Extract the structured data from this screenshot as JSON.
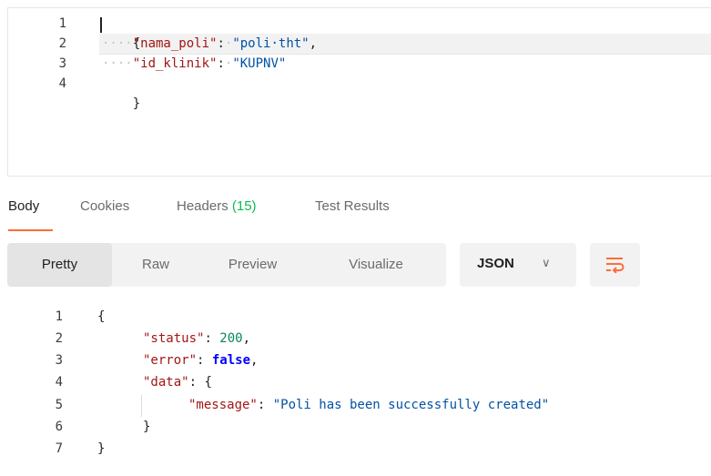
{
  "request": {
    "line_numbers": [
      "1",
      "2",
      "3",
      "4"
    ],
    "lines": {
      "l1": {
        "open": "{"
      },
      "l2": {
        "indent": "····",
        "key": "\"nama_poli\"",
        "colon": ":",
        "sep": "·",
        "value": "\"poli·tht\"",
        "comma": ","
      },
      "l3": {
        "indent": "····",
        "key": "\"id_klinik\"",
        "colon": ":",
        "sep": "·",
        "value": "\"KUPNV\""
      },
      "l4": {
        "close": "}"
      }
    }
  },
  "response_tabs": {
    "body": "Body",
    "cookies": "Cookies",
    "headers_label": "Headers",
    "headers_count": "(15)",
    "test_results": "Test Results"
  },
  "view_modes": {
    "pretty": "Pretty",
    "raw": "Raw",
    "preview": "Preview",
    "visualize": "Visualize"
  },
  "format": {
    "selected": "JSON",
    "chevron": "∨"
  },
  "wrap_icon": "wrap-lines-icon",
  "response": {
    "line_numbers": [
      "1",
      "2",
      "3",
      "4",
      "5",
      "6",
      "7"
    ],
    "lines": {
      "l1": {
        "open": "{"
      },
      "l2": {
        "key": "\"status\"",
        "colon": ": ",
        "value": "200",
        "comma": ","
      },
      "l3": {
        "key": "\"error\"",
        "colon": ": ",
        "value": "false",
        "comma": ","
      },
      "l4": {
        "key": "\"data\"",
        "colon": ": ",
        "open": "{"
      },
      "l5": {
        "key": "\"message\"",
        "colon": ": ",
        "value": "\"Poli has been successfully created\""
      },
      "l6": {
        "close": "}"
      },
      "l7": {
        "close": "}"
      }
    }
  },
  "colors": {
    "accent": "#ff6c37",
    "headers_count": "#0cbb52",
    "json_key": "#a31515",
    "json_string": "#0451a5",
    "json_number": "#098658",
    "json_boolean": "#0000ff"
  }
}
